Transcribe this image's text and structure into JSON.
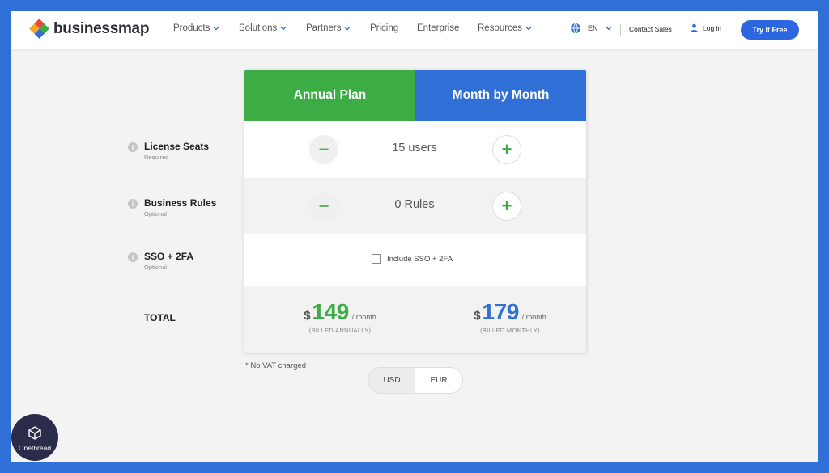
{
  "brand": {
    "name": "businessmap",
    "colors": {
      "green": "#3cad45",
      "blue": "#2f6fd6",
      "button_blue": "#2c66e0"
    }
  },
  "nav": {
    "items": [
      {
        "label": "Products",
        "dropdown": true
      },
      {
        "label": "Solutions",
        "dropdown": true
      },
      {
        "label": "Partners",
        "dropdown": true
      },
      {
        "label": "Pricing",
        "dropdown": false
      },
      {
        "label": "Enterprise",
        "dropdown": false
      },
      {
        "label": "Resources",
        "dropdown": true
      }
    ],
    "language": "EN",
    "contact_sales": "Contact Sales",
    "login": "Log in",
    "try_free": "Try It Free"
  },
  "pricing": {
    "tabs": {
      "annual": "Annual Plan",
      "monthly": "Month by Month"
    },
    "rows": [
      {
        "title": "License Seats",
        "subtitle": "Required",
        "value": "15 users"
      },
      {
        "title": "Business Rules",
        "subtitle": "Optional",
        "value": "0 Rules"
      },
      {
        "title": "SSO + 2FA",
        "subtitle": "Optional",
        "checkbox_label": "Include SSO + 2FA",
        "checked": false
      }
    ],
    "total_label": "TOTAL",
    "annual_price": {
      "currency": "$",
      "amount": "149",
      "period": "/ month",
      "billed": "(BILLED ANNUALLY)"
    },
    "monthly_price": {
      "currency": "$",
      "amount": "179",
      "period": "/ month",
      "billed": "(BILLED MONTHLY)"
    },
    "vat_note": "* No VAT charged",
    "currencies": [
      "USD",
      "EUR"
    ],
    "selected_currency": "EUR"
  },
  "watermark": {
    "label": "Onethread"
  }
}
